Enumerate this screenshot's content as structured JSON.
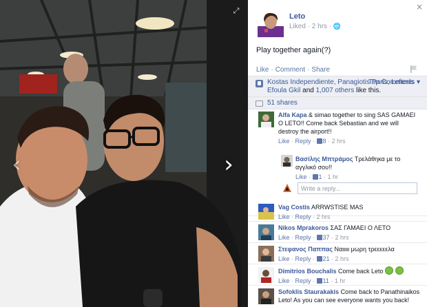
{
  "photo": {
    "next_arrow": "›",
    "prev_arrow": "‹",
    "expand_icon": "⤢"
  },
  "post": {
    "author": "Leto",
    "meta_prefix": "Liked · 2 hrs ·",
    "meta_icon": "globe-icon",
    "text": "Play together again(?)",
    "actions": [
      "Like",
      "Comment",
      "Share"
    ]
  },
  "likes": {
    "names": "Kostas Independiente, Panagiotis Paris, Lefteris Efoula Gkil",
    "and_text": "and",
    "others": "1,007 others",
    "like_this": "like this.",
    "top_comments": "Top Comments ▾"
  },
  "shares": {
    "label": "51 shares"
  },
  "comments": [
    {
      "author": "Alfa Kapa",
      "text": "& simao together to sing SAS GAMAEI O LETO!! Come back Sebastian and we will destroy the airport!!",
      "like": "Like",
      "reply": "Reply",
      "likes": "8",
      "time": "2 hrs",
      "avatar_color": "#3c6a3a"
    },
    {
      "author": "Vag Costis",
      "text": "ARRWSTISE MAS",
      "like": "Like",
      "reply": "Reply",
      "likes": "",
      "time": "2 hrs",
      "avatar_color": "#2b5bbf"
    },
    {
      "author": "Nikos Mprakoros",
      "text": "ΣΑΣ ΓΑΜΑΕΙ Ο ΛΕΤΟ",
      "like": "Like",
      "reply": "Reply",
      "likes": "37",
      "time": "2 hrs",
      "avatar_color": "#4a7a9a"
    },
    {
      "author": "Στεφανος Παππας",
      "text": "Ναιιιιι μωρη τρεεεεελα",
      "like": "Like",
      "reply": "Reply",
      "likes": "21",
      "time": "2 hrs",
      "avatar_color": "#8a6e58"
    },
    {
      "author": "Dimitrios Bouchalis",
      "text": "Come back Leto",
      "like": "Like",
      "reply": "Reply",
      "likes": "11",
      "time": "1 hr",
      "avatar_color": "#6a4c3c"
    },
    {
      "author": "Sofoklis Staurakakis",
      "text": "Come back to Panathinaikos Leto! As you can see everyone wants you back!",
      "like": "",
      "reply": "",
      "likes": "",
      "time": "",
      "avatar_color": "#5a5048"
    }
  ],
  "reply_comment": {
    "author": "Βασίλης Μπτράμος",
    "text": "Τρελάθηκα με το αγγλικό σου!!",
    "like": "Like",
    "likes": "1",
    "time": "1 hr"
  },
  "reply_input": {
    "placeholder": "Write a reply..."
  },
  "close_icon": "×",
  "colors": {
    "fb_blue": "#3b5998",
    "link": "#5a74a8",
    "meta_gray": "#9197a3"
  }
}
